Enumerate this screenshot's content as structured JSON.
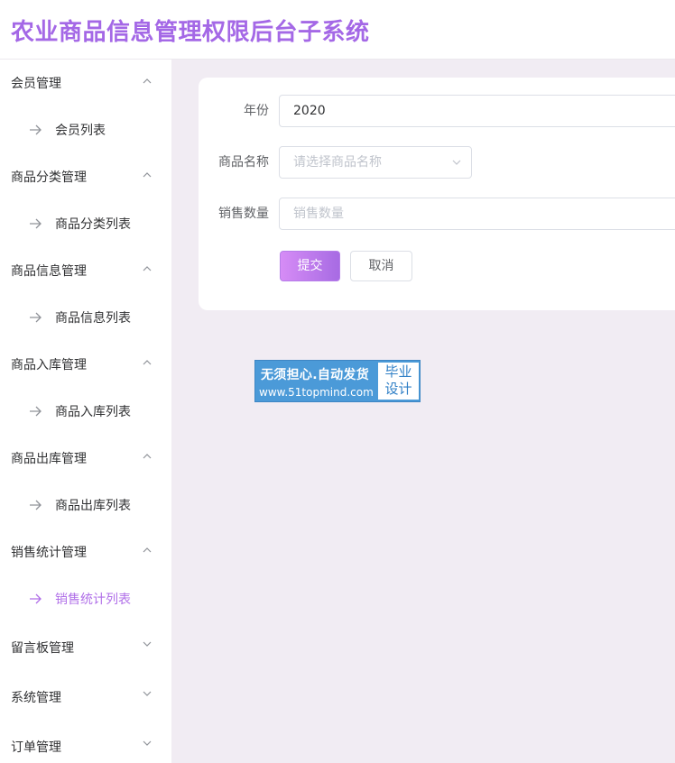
{
  "header": {
    "title": "农业商品信息管理权限后台子系统"
  },
  "sidebar": {
    "groups": [
      {
        "label": "会员管理",
        "item": "会员列表"
      },
      {
        "label": "商品分类管理",
        "item": "商品分类列表"
      },
      {
        "label": "商品信息管理",
        "item": "商品信息列表"
      },
      {
        "label": "商品入库管理",
        "item": "商品入库列表"
      },
      {
        "label": "商品出库管理",
        "item": "商品出库列表"
      },
      {
        "label": "销售统计管理",
        "item": "销售统计列表"
      }
    ],
    "closed_groups": [
      {
        "label": "留言板管理"
      },
      {
        "label": "系统管理"
      },
      {
        "label": "订单管理"
      }
    ],
    "active_item": "销售统计列表"
  },
  "form": {
    "year": {
      "label": "年份",
      "value": "2020"
    },
    "product_name": {
      "label": "商品名称",
      "placeholder": "请选择商品名称"
    },
    "sales_qty": {
      "label": "销售数量",
      "placeholder": "销售数量"
    },
    "submit_label": "提交",
    "cancel_label": "取消"
  },
  "watermark": {
    "line1": "无须担心.自动发货",
    "line2": "www.51topmind.com",
    "right_top": "毕业",
    "right_bottom": "设计"
  },
  "colors": {
    "accent": "#a468e6",
    "background": "#f1ecf3",
    "watermark": "#4b9ad8"
  }
}
